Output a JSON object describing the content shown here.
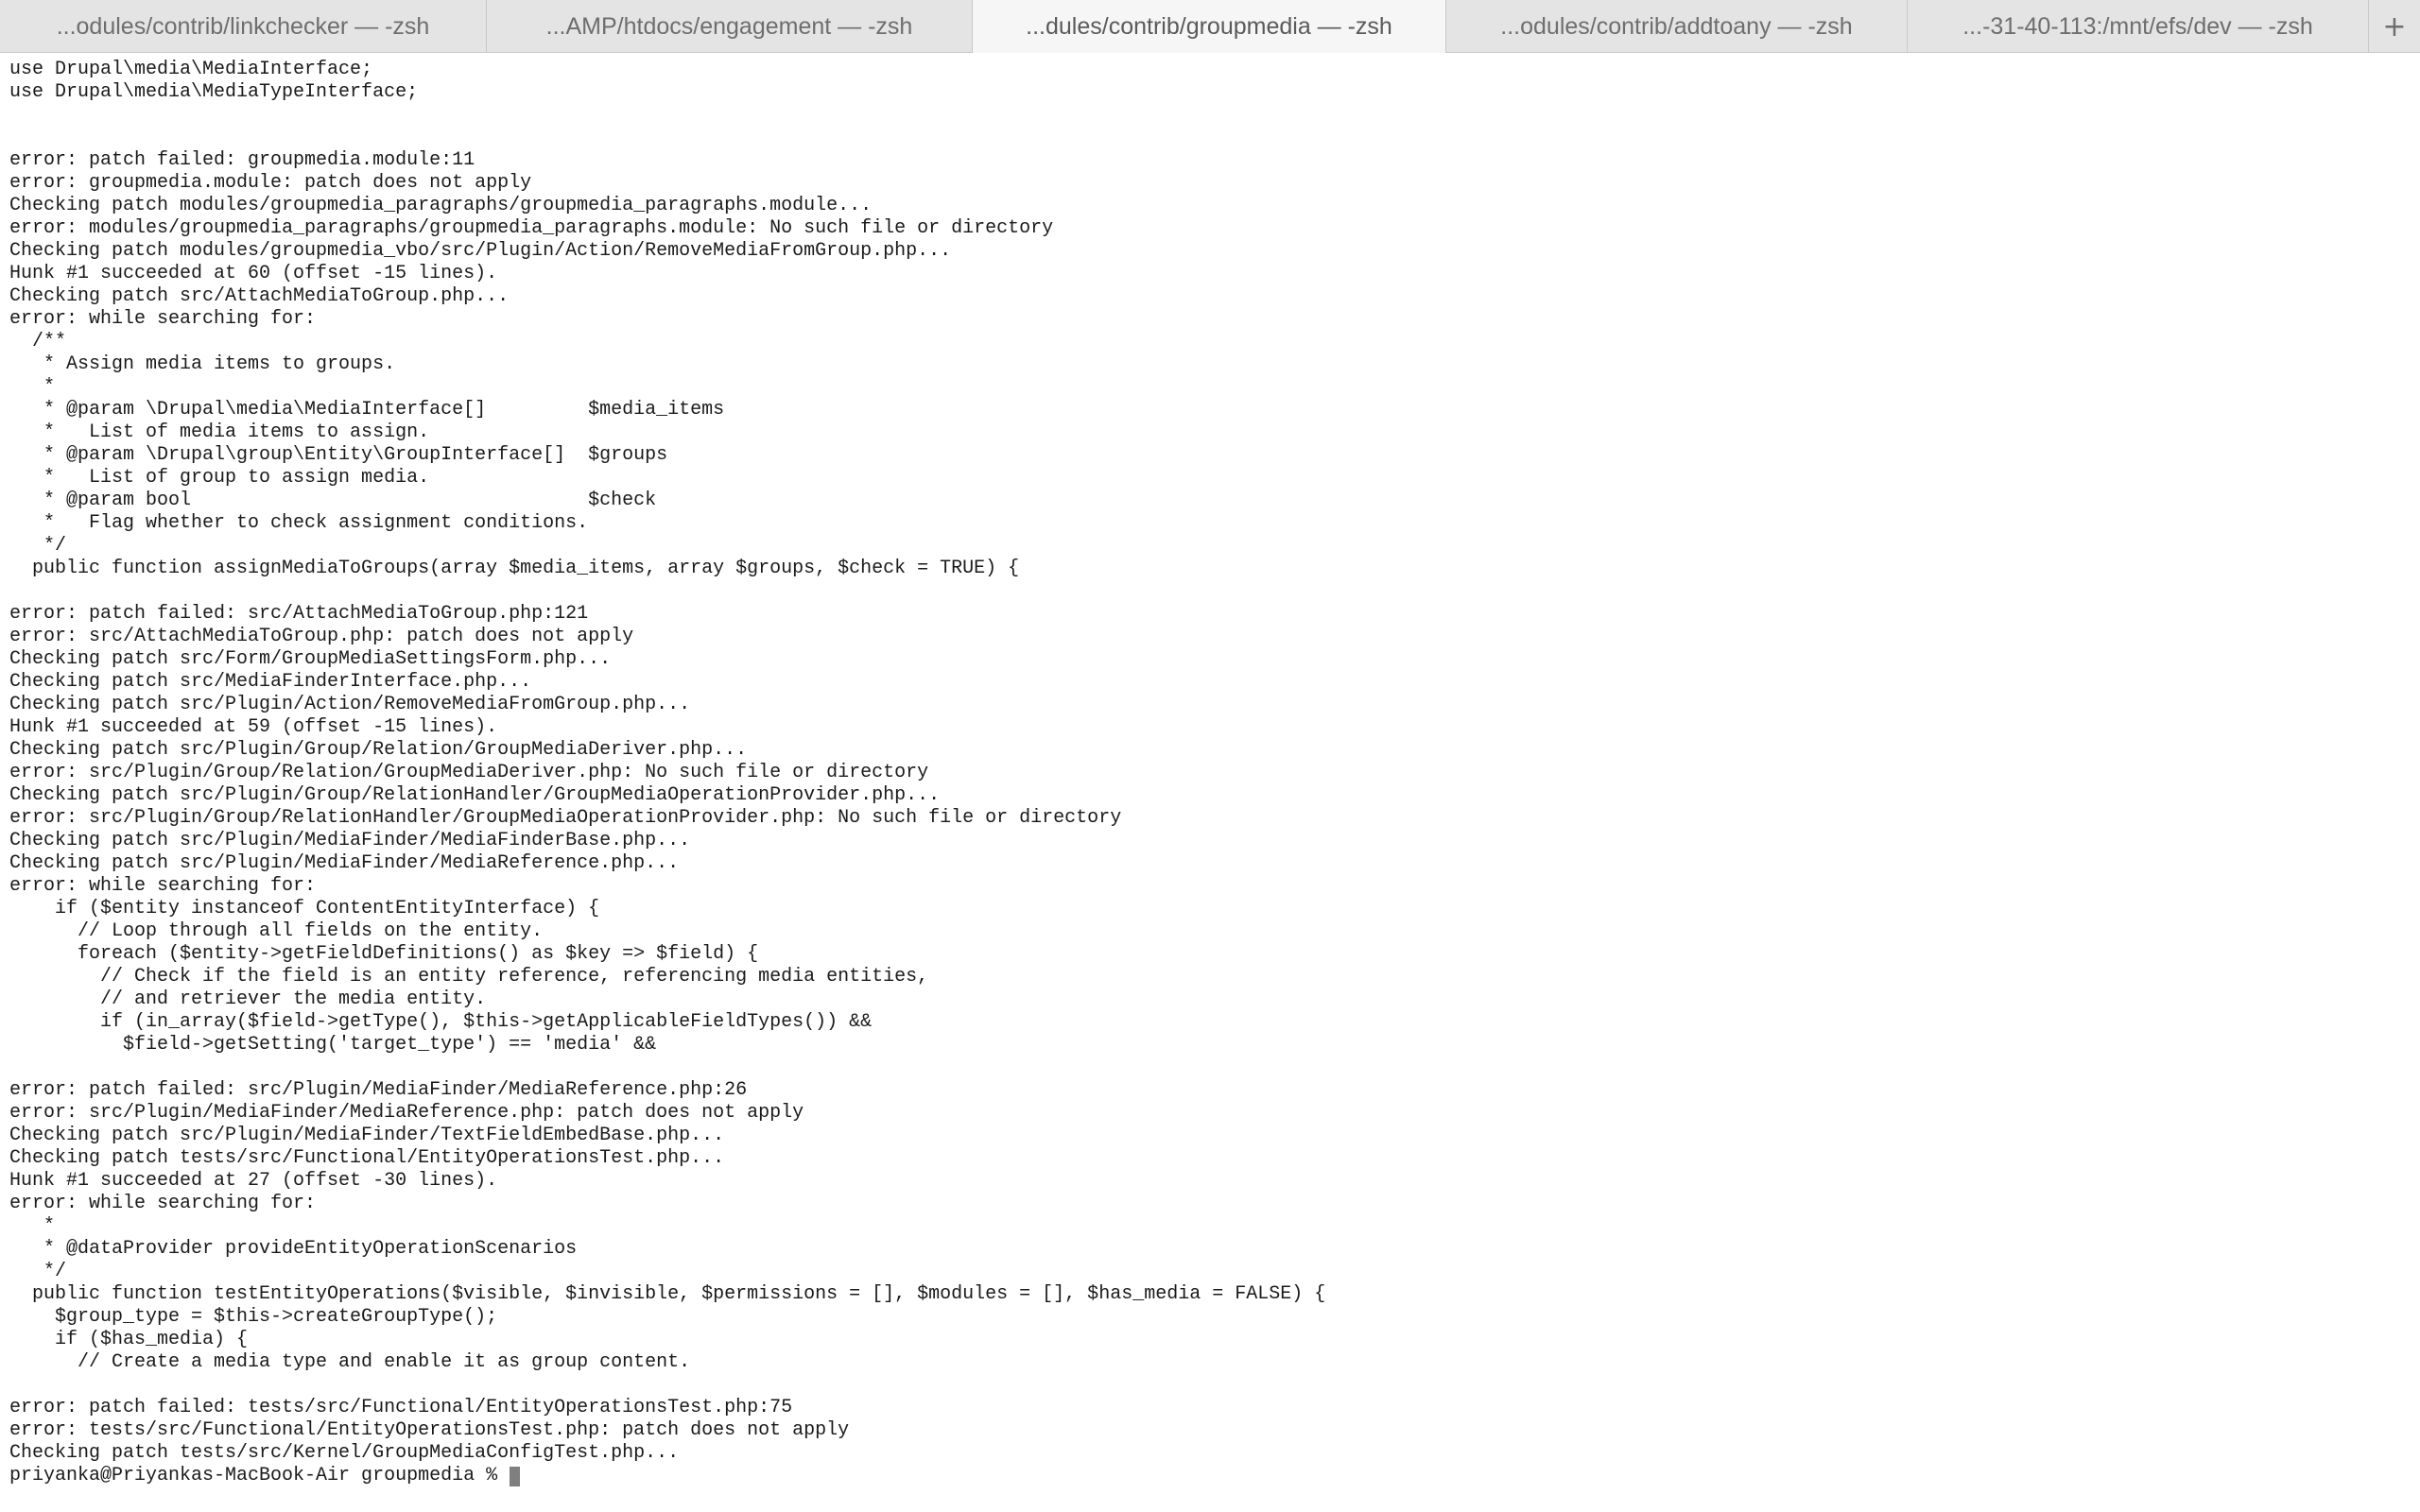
{
  "tabs": [
    {
      "label": "...odules/contrib/linkchecker — -zsh",
      "active": false
    },
    {
      "label": "...AMP/htdocs/engagement — -zsh",
      "active": false
    },
    {
      "label": "...dules/contrib/groupmedia — -zsh",
      "active": true
    },
    {
      "label": "...odules/contrib/addtoany — -zsh",
      "active": false
    },
    {
      "label": "...-31-40-113:/mnt/efs/dev — -zsh",
      "active": false
    }
  ],
  "new_tab_label": "+",
  "terminal": {
    "lines": [
      "use Drupal\\media\\MediaInterface;",
      "use Drupal\\media\\MediaTypeInterface;",
      "",
      "",
      "error: patch failed: groupmedia.module:11",
      "error: groupmedia.module: patch does not apply",
      "Checking patch modules/groupmedia_paragraphs/groupmedia_paragraphs.module...",
      "error: modules/groupmedia_paragraphs/groupmedia_paragraphs.module: No such file or directory",
      "Checking patch modules/groupmedia_vbo/src/Plugin/Action/RemoveMediaFromGroup.php...",
      "Hunk #1 succeeded at 60 (offset -15 lines).",
      "Checking patch src/AttachMediaToGroup.php...",
      "error: while searching for:",
      "  /**",
      "   * Assign media items to groups.",
      "   *",
      "   * @param \\Drupal\\media\\MediaInterface[]         $media_items",
      "   *   List of media items to assign.",
      "   * @param \\Drupal\\group\\Entity\\GroupInterface[]  $groups",
      "   *   List of group to assign media.",
      "   * @param bool                                   $check",
      "   *   Flag whether to check assignment conditions.",
      "   */",
      "  public function assignMediaToGroups(array $media_items, array $groups, $check = TRUE) {",
      "",
      "error: patch failed: src/AttachMediaToGroup.php:121",
      "error: src/AttachMediaToGroup.php: patch does not apply",
      "Checking patch src/Form/GroupMediaSettingsForm.php...",
      "Checking patch src/MediaFinderInterface.php...",
      "Checking patch src/Plugin/Action/RemoveMediaFromGroup.php...",
      "Hunk #1 succeeded at 59 (offset -15 lines).",
      "Checking patch src/Plugin/Group/Relation/GroupMediaDeriver.php...",
      "error: src/Plugin/Group/Relation/GroupMediaDeriver.php: No such file or directory",
      "Checking patch src/Plugin/Group/RelationHandler/GroupMediaOperationProvider.php...",
      "error: src/Plugin/Group/RelationHandler/GroupMediaOperationProvider.php: No such file or directory",
      "Checking patch src/Plugin/MediaFinder/MediaFinderBase.php...",
      "Checking patch src/Plugin/MediaFinder/MediaReference.php...",
      "error: while searching for:",
      "    if ($entity instanceof ContentEntityInterface) {",
      "      // Loop through all fields on the entity.",
      "      foreach ($entity->getFieldDefinitions() as $key => $field) {",
      "        // Check if the field is an entity reference, referencing media entities,",
      "        // and retriever the media entity.",
      "        if (in_array($field->getType(), $this->getApplicableFieldTypes()) &&",
      "          $field->getSetting('target_type') == 'media' &&",
      "",
      "error: patch failed: src/Plugin/MediaFinder/MediaReference.php:26",
      "error: src/Plugin/MediaFinder/MediaReference.php: patch does not apply",
      "Checking patch src/Plugin/MediaFinder/TextFieldEmbedBase.php...",
      "Checking patch tests/src/Functional/EntityOperationsTest.php...",
      "Hunk #1 succeeded at 27 (offset -30 lines).",
      "error: while searching for:",
      "   *",
      "   * @dataProvider provideEntityOperationScenarios",
      "   */",
      "  public function testEntityOperations($visible, $invisible, $permissions = [], $modules = [], $has_media = FALSE) {",
      "    $group_type = $this->createGroupType();",
      "    if ($has_media) {",
      "      // Create a media type and enable it as group content.",
      "",
      "error: patch failed: tests/src/Functional/EntityOperationsTest.php:75",
      "error: tests/src/Functional/EntityOperationsTest.php: patch does not apply",
      "Checking patch tests/src/Kernel/GroupMediaConfigTest.php..."
    ],
    "prompt": "priyanka@Priyankas-MacBook-Air groupmedia % "
  }
}
